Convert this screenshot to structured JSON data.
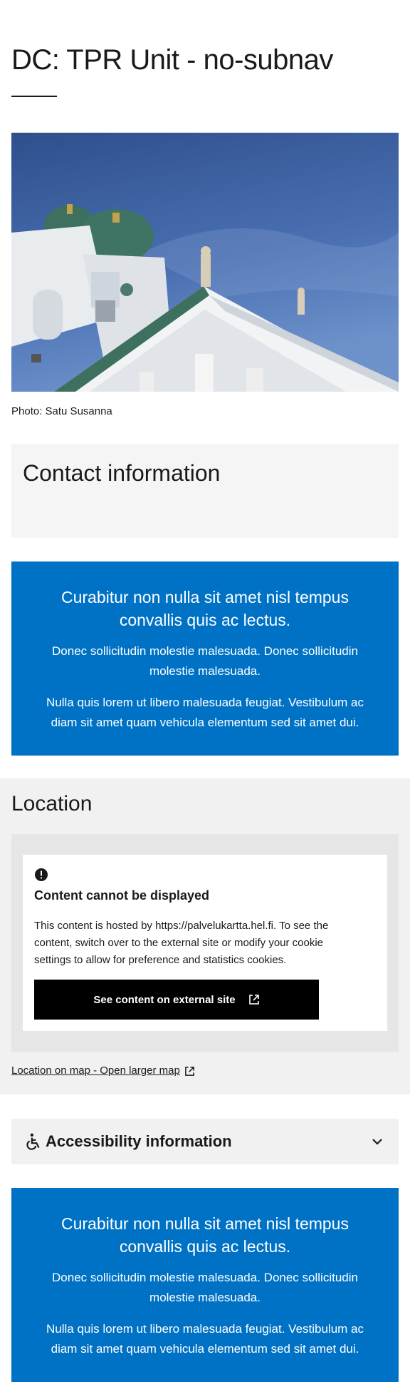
{
  "page": {
    "title": "DC: TPR Unit - no-subnav"
  },
  "hero": {
    "caption": "Photo: Satu Susanna"
  },
  "contact": {
    "heading": "Contact information"
  },
  "banners": [
    {
      "heading": "Curabitur non nulla sit amet nisl tempus convallis quis ac lectus.",
      "paragraph1": "Donec sollicitudin molestie malesuada. Donec sollicitudin molestie malesuada.",
      "paragraph2": "Nulla quis lorem ut libero malesuada feugiat. Vestibulum ac diam sit amet quam vehicula elementum sed sit amet dui."
    },
    {
      "heading": "Curabitur non nulla sit amet nisl tempus convallis quis ac lectus.",
      "paragraph1": "Donec sollicitudin molestie malesuada. Donec sollicitudin molestie malesuada.",
      "paragraph2": "Nulla quis lorem ut libero malesuada feugiat. Vestibulum ac diam sit amet quam vehicula elementum sed sit amet dui."
    }
  ],
  "location": {
    "heading": "Location",
    "notice_title": "Content cannot be displayed",
    "notice_text": "This content is hosted by https://palvelukartta.hel.fi. To see the content, switch over to the external site or modify your cookie settings to allow for preference and statistics cookies.",
    "button_label": "See content on external site",
    "map_link": "Location on map - Open larger map"
  },
  "accessibility": {
    "heading": "Accessibility information"
  },
  "colors": {
    "banner_blue": "#0072c6",
    "sky": "#3b5fa0"
  },
  "icons": {
    "alert": "alert-circle-icon",
    "external": "external-link-icon",
    "accessibility": "wheelchair-icon",
    "expand": "chevron-down-icon"
  }
}
